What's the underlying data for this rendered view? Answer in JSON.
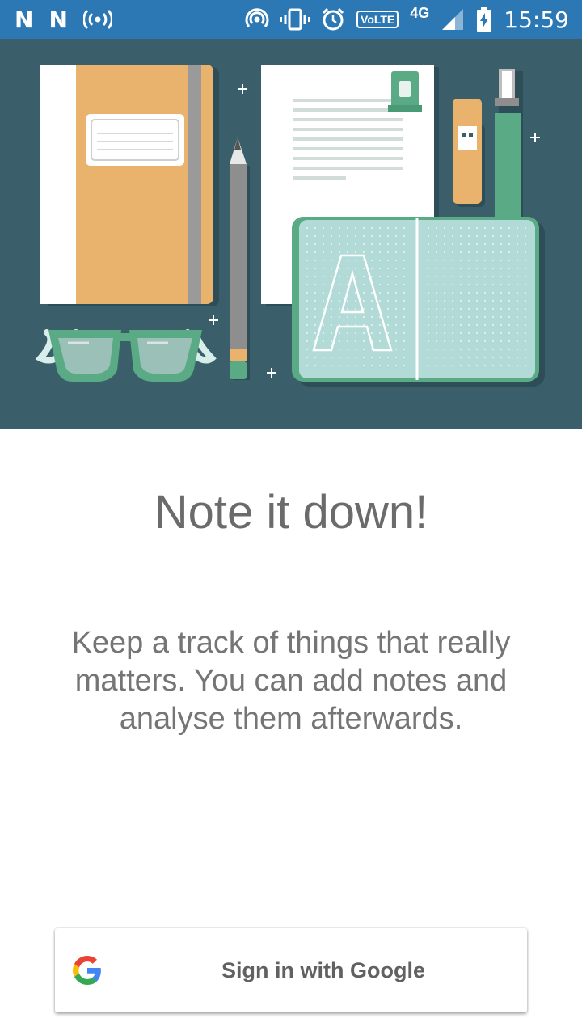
{
  "status_bar": {
    "left_icons": [
      "n-notification-icon",
      "n-notification-icon",
      "hotspot-broadcast-icon"
    ],
    "n_glyph": "N",
    "volte": "VoLTE",
    "network": "4G",
    "time": "15:59"
  },
  "illustration": {
    "notebook_letter": "A",
    "colors": {
      "background": "#3a5f6b",
      "orange": "#e9b36e",
      "green": "#5aab85",
      "teal_paper": "#b2dbd8"
    }
  },
  "onboarding": {
    "title": "Note it down!",
    "description": "Keep a track of things that really matters. You can add notes and analyse them afterwards."
  },
  "signin": {
    "label": "Sign in with Google",
    "icon": "google-g-icon"
  }
}
